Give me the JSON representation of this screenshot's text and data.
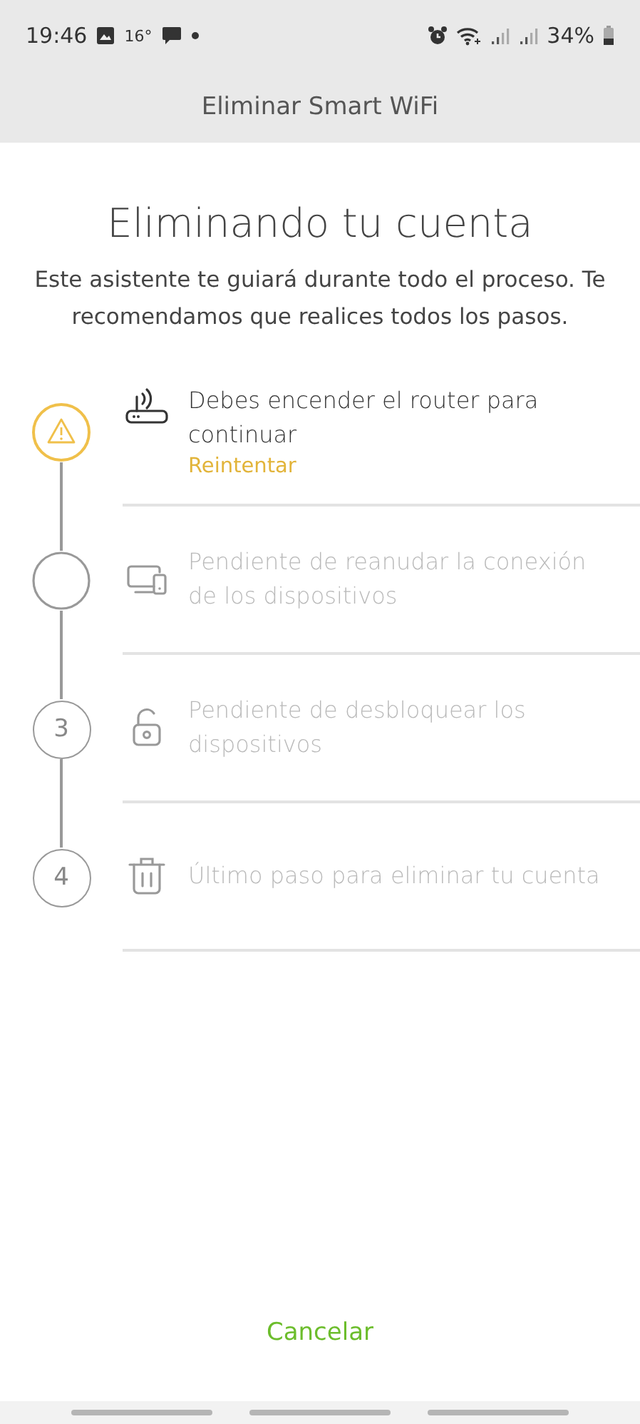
{
  "status_bar": {
    "time": "19:46",
    "temperature": "16°",
    "battery": "34%"
  },
  "app_bar": {
    "title": "Eliminar Smart WiFi"
  },
  "heading": "Eliminando tu cuenta",
  "description": "Este asistente te guiará durante todo el proceso. Te recomendamos que realices todos los pasos.",
  "steps": [
    {
      "kind": "warning",
      "disabled": false,
      "text": "Debes encender el router para continuar",
      "action": "Reintentar"
    },
    {
      "kind": "empty",
      "disabled": true,
      "text": "Pendiente de reanudar la conexión de los dispositivos"
    },
    {
      "kind": "number",
      "number": "3",
      "disabled": true,
      "text": "Pendiente de desbloquear los dispositivos"
    },
    {
      "kind": "number",
      "number": "4",
      "disabled": true,
      "text": "Último paso para eliminar tu cuenta"
    }
  ],
  "cancel_button": "Cancelar"
}
